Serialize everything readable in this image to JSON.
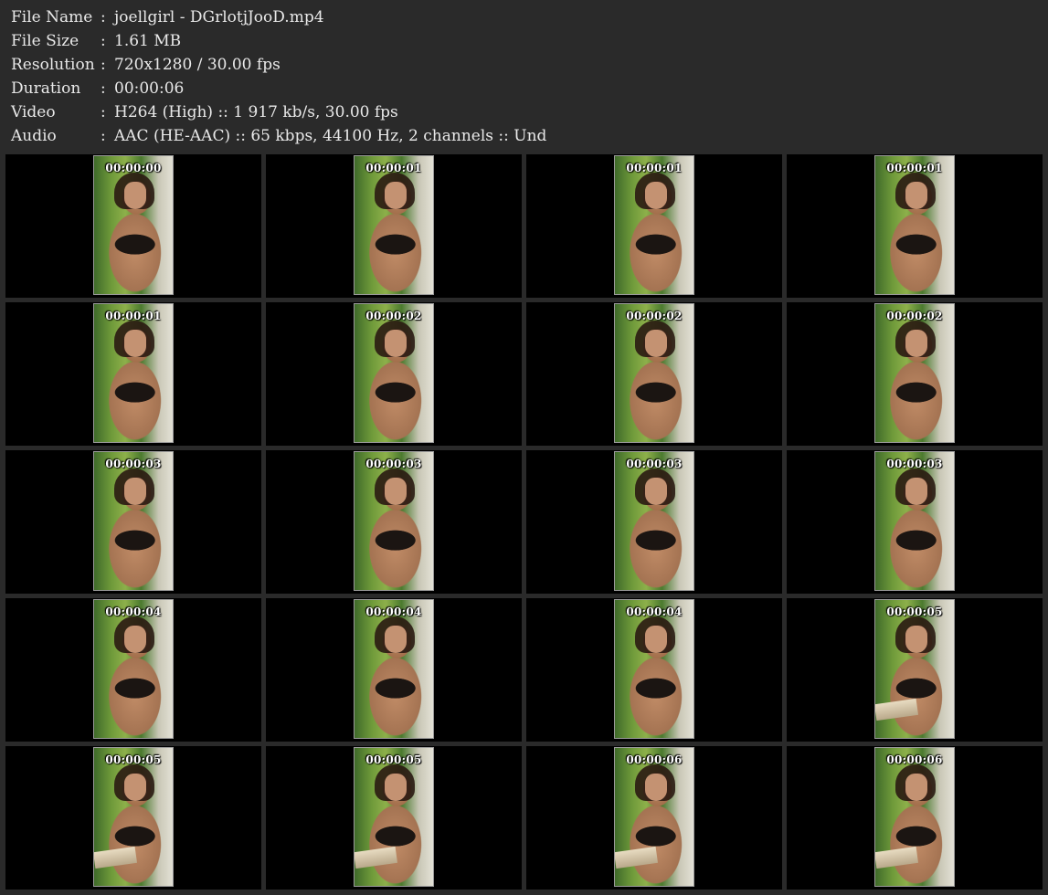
{
  "info": [
    {
      "label": "File Name",
      "value": "joellgirl - DGrlotjJooD.mp4"
    },
    {
      "label": "File Size",
      "value": "1.61 MB"
    },
    {
      "label": "Resolution",
      "value": "720x1280 / 30.00 fps"
    },
    {
      "label": "Duration",
      "value": "00:00:06"
    },
    {
      "label": "Video",
      "value": "H264 (High) :: 1 917 kb/s, 30.00 fps"
    },
    {
      "label": "Audio",
      "value": "AAC (HE-AAC) :: 65 kbps, 44100 Hz, 2 channels :: Und"
    }
  ],
  "separator": ":",
  "thumbnails": [
    {
      "time": "00:00:00",
      "book": false
    },
    {
      "time": "00:00:01",
      "book": false
    },
    {
      "time": "00:00:01",
      "book": false
    },
    {
      "time": "00:00:01",
      "book": false
    },
    {
      "time": "00:00:01",
      "book": false
    },
    {
      "time": "00:00:02",
      "book": false
    },
    {
      "time": "00:00:02",
      "book": false
    },
    {
      "time": "00:00:02",
      "book": false
    },
    {
      "time": "00:00:03",
      "book": false
    },
    {
      "time": "00:00:03",
      "book": false
    },
    {
      "time": "00:00:03",
      "book": false
    },
    {
      "time": "00:00:03",
      "book": false
    },
    {
      "time": "00:00:04",
      "book": false
    },
    {
      "time": "00:00:04",
      "book": false
    },
    {
      "time": "00:00:04",
      "book": false
    },
    {
      "time": "00:00:05",
      "book": true
    },
    {
      "time": "00:00:05",
      "book": true
    },
    {
      "time": "00:00:05",
      "book": true
    },
    {
      "time": "00:00:06",
      "book": true
    },
    {
      "time": "00:00:06",
      "book": true
    }
  ]
}
